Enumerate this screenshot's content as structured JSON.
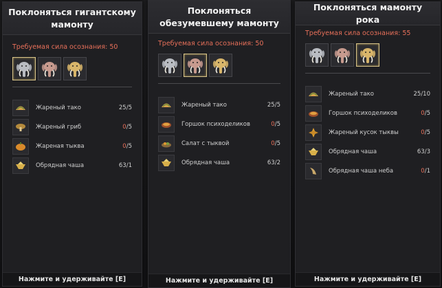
{
  "panels": [
    {
      "title": "Поклоняться гигантскому мамонту",
      "required_label": "Требуемая сила осознания:",
      "required_value": "50",
      "selected_mammoth": 0,
      "items": [
        {
          "name": "Жареный тако",
          "have": "25",
          "need": "5",
          "icon": "taco-icon"
        },
        {
          "name": "Жареный гриб",
          "have": "0",
          "need": "5",
          "icon": "mushroom-icon"
        },
        {
          "name": "Жареная тыква",
          "have": "0",
          "need": "5",
          "icon": "pumpkin-icon"
        },
        {
          "name": "Обрядная чаша",
          "have": "63",
          "need": "1",
          "icon": "ritual-bowl-icon"
        }
      ],
      "footer": "Нажмите и удерживайте [E]"
    },
    {
      "title": "Поклоняться обезумевшему мамонту",
      "required_label": "Требуемая сила осознания:",
      "required_value": "50",
      "selected_mammoth": 1,
      "items": [
        {
          "name": "Жареный тако",
          "have": "25",
          "need": "5",
          "icon": "taco-icon"
        },
        {
          "name": "Горшок психоделиков",
          "have": "0",
          "need": "5",
          "icon": "psychedelic-pot-icon"
        },
        {
          "name": "Салат с тыквой",
          "have": "0",
          "need": "5",
          "icon": "pumpkin-salad-icon"
        },
        {
          "name": "Обрядная чаша",
          "have": "63",
          "need": "2",
          "icon": "ritual-bowl-icon"
        }
      ],
      "footer": "Нажмите и удерживайте [E]"
    },
    {
      "title": "Поклоняться мамонту рока",
      "required_label": "Требуемая сила осознания:",
      "required_value": "55",
      "selected_mammoth": 2,
      "items": [
        {
          "name": "Жареный тако",
          "have": "25",
          "need": "10",
          "icon": "taco-icon"
        },
        {
          "name": "Горшок психоделиков",
          "have": "0",
          "need": "5",
          "icon": "psychedelic-pot-icon"
        },
        {
          "name": "Жареный кусок тыквы",
          "have": "0",
          "need": "5",
          "icon": "pumpkin-slice-icon"
        },
        {
          "name": "Обрядная чаша",
          "have": "63",
          "need": "3",
          "icon": "ritual-bowl-icon"
        },
        {
          "name": "Обрядная чаша неба",
          "have": "0",
          "need": "1",
          "icon": "sky-bowl-icon"
        }
      ],
      "footer": "Нажмите и удерживайте [E]"
    }
  ],
  "mammoths": [
    {
      "name": "giant-mammoth-icon",
      "color": "#b9bcc2"
    },
    {
      "name": "crazed-mammoth-icon",
      "color": "#c79a8e"
    },
    {
      "name": "doom-mammoth-icon",
      "color": "#d8b56a"
    }
  ],
  "colors": {
    "accent_red": "#e8705a",
    "panel_bg": "#1f1f22",
    "selected_border": "#d8c48a"
  }
}
